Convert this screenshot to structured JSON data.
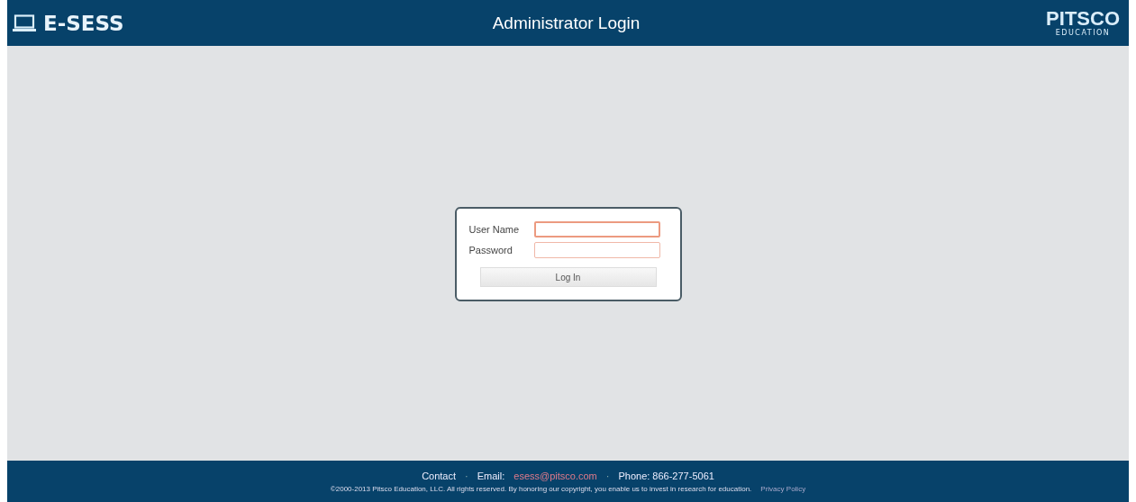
{
  "header": {
    "brand": "E-SESS",
    "title": "Administrator Login",
    "logo": "PITSCO",
    "logo_sub": "EDUCATION"
  },
  "login": {
    "fields": [
      {
        "label": "User Name",
        "focused": true
      },
      {
        "label": "Password",
        "focused": false
      }
    ],
    "button": "Log In"
  },
  "footer": {
    "contact": "Contact",
    "separators": [
      "·",
      "·"
    ],
    "email_label": "Email:",
    "email": "esess@pitsco.com",
    "phone": "Phone: 866-277-5061",
    "copyright": "©2000-2013 Pitsco Education, LLC. All rights reserved. By honoring our copyright, you enable us to invest in research for education.",
    "privacy": "Privacy Policy"
  }
}
